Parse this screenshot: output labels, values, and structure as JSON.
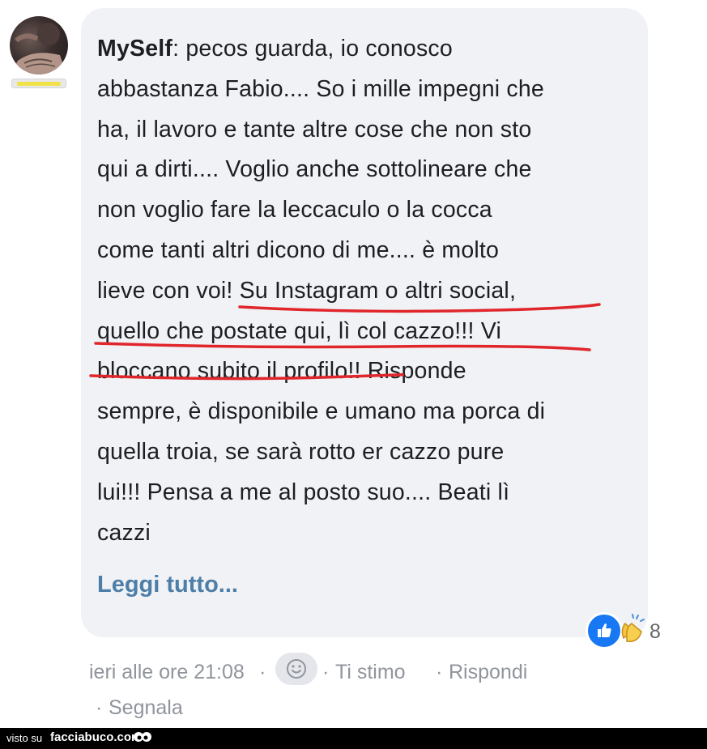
{
  "comment": {
    "author": "MySelf",
    "separator": ": ",
    "lines": [
      "pecos guarda, io conosco",
      "abbastanza Fabio.... So i mille impegni che",
      "ha, il lavoro e tante altre cose che non sto",
      "qui a dirti.... Voglio anche sottolineare che",
      "non voglio fare la leccaculo o la cocca",
      "come tanti altri dicono di me.... è molto",
      "lieve con voi! Su Instagram o altri social,",
      "quello che postate qui, lì col cazzo!!! Vi",
      "bloccano subito il profilo!! Risponde",
      "sempre, è disponibile e umano ma porca di",
      "quella troia, se sarà rotto er cazzo pure",
      "lui!!! Pensa a me al posto suo.... Beati lì",
      "cazzi"
    ],
    "read_more": "Leggi tutto..."
  },
  "reactions": {
    "icons": [
      "like-icon",
      "clapping-hands-icon"
    ],
    "count": "8"
  },
  "meta": {
    "timestamp": "ieri alle ore 21:08",
    "dot": "·",
    "react_label": "Ti stimo",
    "reply_label": "Rispondi",
    "report_label": "Segnala"
  },
  "footer": {
    "visto_su": "visto su",
    "site": "facciabuco.com"
  },
  "colors": {
    "bubble": "#f0f2f5",
    "link": "#4d7ea8",
    "underline": "#e0262b",
    "like": "#1877f2"
  }
}
